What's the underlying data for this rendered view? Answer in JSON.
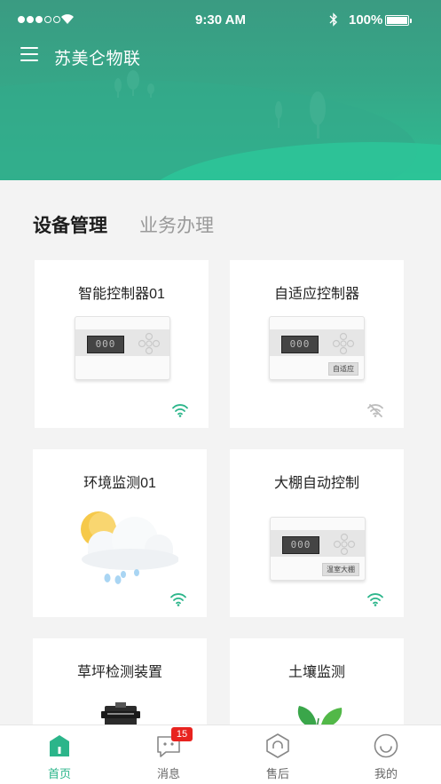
{
  "status_bar": {
    "time": "9:30 AM",
    "battery": "100%",
    "signal_strength_dots": 3
  },
  "header": {
    "title": "苏美仑物联",
    "menu_icon": "hamburger-menu-icon",
    "colors": {
      "top": "#3a9b82",
      "bottom": "#2ebd92"
    }
  },
  "section_tabs": [
    {
      "label": "设备管理",
      "active": true
    },
    {
      "label": "业务办理",
      "active": false
    }
  ],
  "devices": [
    {
      "title": "智能控制器01",
      "image": "controller",
      "display": "000",
      "tag": "",
      "wifi": "online"
    },
    {
      "title": "自适应控制器",
      "image": "controller",
      "display": "000",
      "tag": "自适应",
      "wifi": "offline"
    },
    {
      "title": "环境监测01",
      "image": "weather-cloud-sun-rain",
      "wifi": "online"
    },
    {
      "title": "大棚自动控制",
      "image": "controller",
      "display": "000",
      "tag": "温室大棚",
      "wifi": "online"
    },
    {
      "title": "草坪检测装置",
      "image": "sensor-device"
    },
    {
      "title": "土壤监测",
      "image": "plant-sprout"
    }
  ],
  "tabbar": [
    {
      "label": "首页",
      "icon": "home-icon",
      "active": true
    },
    {
      "label": "消息",
      "icon": "message-icon",
      "badge": "15",
      "active": false
    },
    {
      "label": "售后",
      "icon": "service-icon",
      "active": false
    },
    {
      "label": "我的",
      "icon": "profile-icon",
      "active": false
    }
  ],
  "accent_color": "#2bb58a",
  "badge_color": "#e8231f"
}
